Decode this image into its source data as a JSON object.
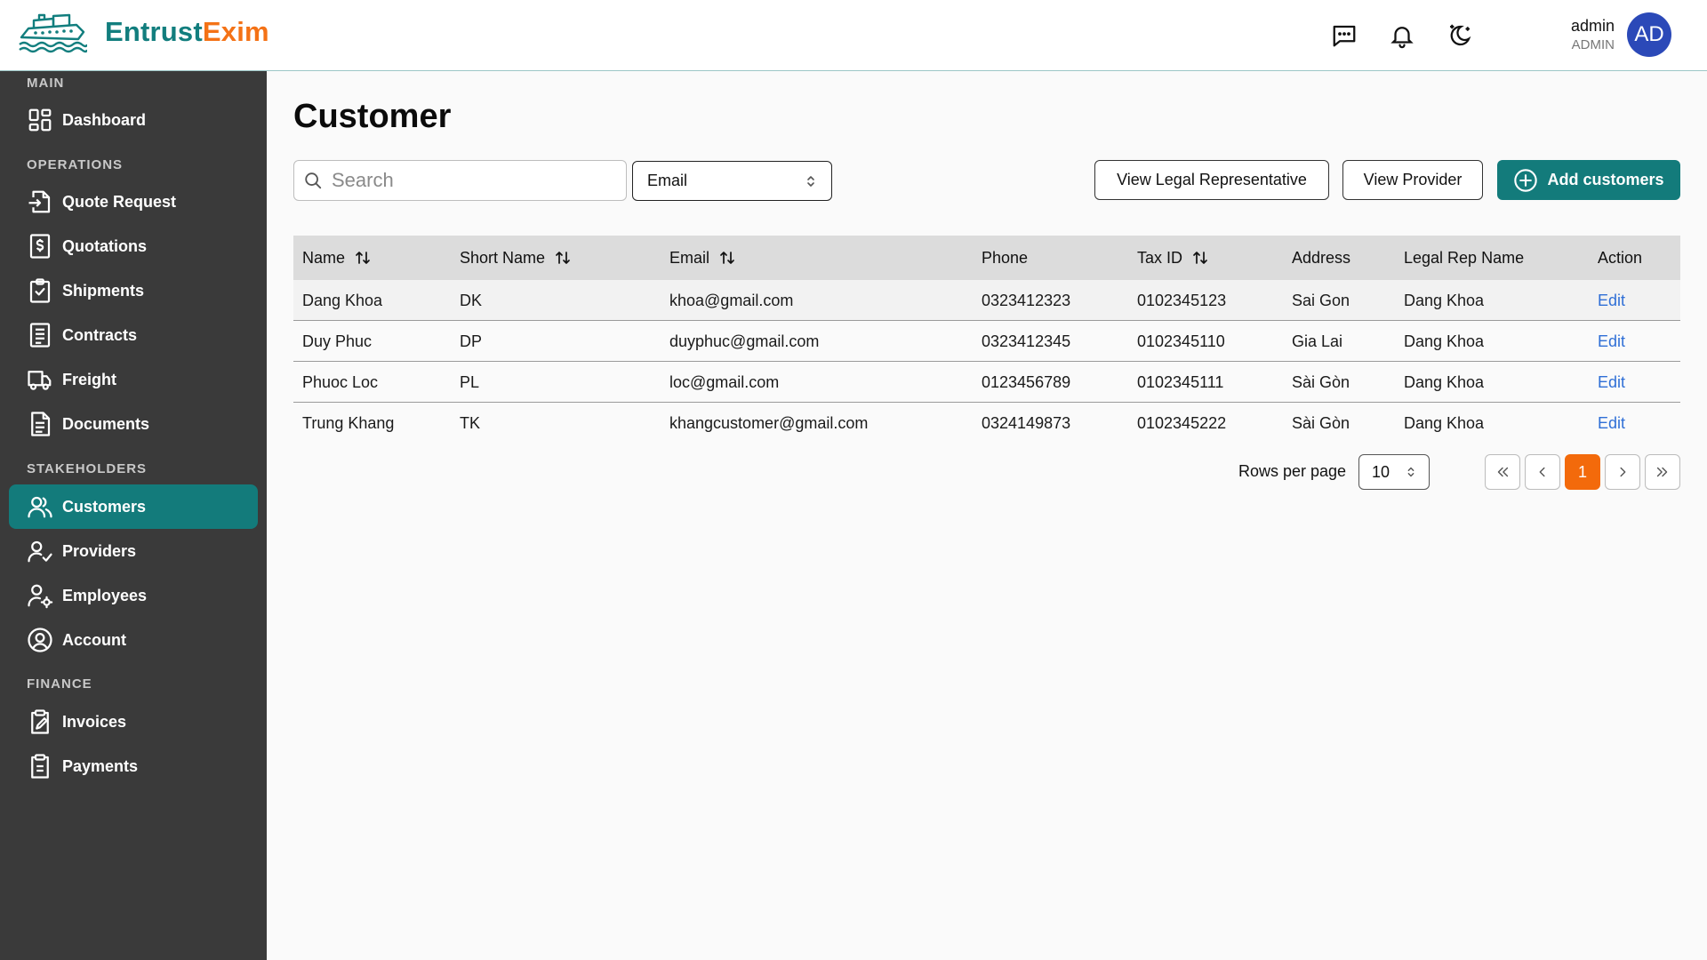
{
  "brand": {
    "part1": "Entrust",
    "part2": "Exim"
  },
  "user": {
    "name": "admin",
    "role": "ADMIN",
    "initials": "AD"
  },
  "sidebar": {
    "sections": [
      {
        "title": "MAIN",
        "items": [
          {
            "label": "Dashboard",
            "icon": "dashboard-icon"
          }
        ]
      },
      {
        "title": "OPERATIONS",
        "items": [
          {
            "label": "Quote Request",
            "icon": "quote-request-icon"
          },
          {
            "label": "Quotations",
            "icon": "quotations-icon"
          },
          {
            "label": "Shipments",
            "icon": "shipments-icon"
          },
          {
            "label": "Contracts",
            "icon": "contracts-icon"
          },
          {
            "label": "Freight",
            "icon": "freight-icon"
          },
          {
            "label": "Documents",
            "icon": "documents-icon"
          }
        ]
      },
      {
        "title": "STAKEHOLDERS",
        "items": [
          {
            "label": "Customers",
            "icon": "customers-icon",
            "active": true
          },
          {
            "label": "Providers",
            "icon": "providers-icon"
          },
          {
            "label": "Employees",
            "icon": "employees-icon"
          },
          {
            "label": "Account",
            "icon": "account-icon"
          }
        ]
      },
      {
        "title": "FINANCE",
        "items": [
          {
            "label": "Invoices",
            "icon": "invoices-icon"
          },
          {
            "label": "Payments",
            "icon": "payments-icon"
          }
        ]
      }
    ]
  },
  "main": {
    "title": "Customer",
    "search_placeholder": "Search",
    "filter_value": "Email",
    "btn_legal": "View Legal Representative",
    "btn_provider": "View Provider",
    "btn_add": "Add customers"
  },
  "table": {
    "columns": [
      "Name",
      "Short Name",
      "Email",
      "Phone",
      "Tax ID",
      "Address",
      "Legal Rep Name",
      "Action"
    ],
    "rows": [
      [
        "Dang Khoa",
        "DK",
        "khoa@gmail.com",
        "0323412323",
        "0102345123",
        "Sai Gon",
        "Dang Khoa",
        "Edit"
      ],
      [
        "Duy Phuc",
        "DP",
        "duyphuc@gmail.com",
        "0323412345",
        "0102345110",
        "Gia Lai",
        "Dang Khoa",
        "Edit"
      ],
      [
        "Phuoc Loc",
        "PL",
        "loc@gmail.com",
        "0123456789",
        "0102345111",
        "Sài Gòn",
        "Dang Khoa",
        "Edit"
      ],
      [
        "Trung Khang",
        "TK",
        "khangcustomer@gmail.com",
        "0324149873",
        "0102345222",
        "Sài Gòn",
        "Dang Khoa",
        "Edit"
      ]
    ]
  },
  "pagination": {
    "rows_label": "Rows per page",
    "rows_value": "10",
    "current_page": "1"
  },
  "colors": {
    "primary": "#137b7b",
    "accent": "#f36a0b",
    "sidebar": "#3a3a3a",
    "link": "#2f6fd6"
  }
}
